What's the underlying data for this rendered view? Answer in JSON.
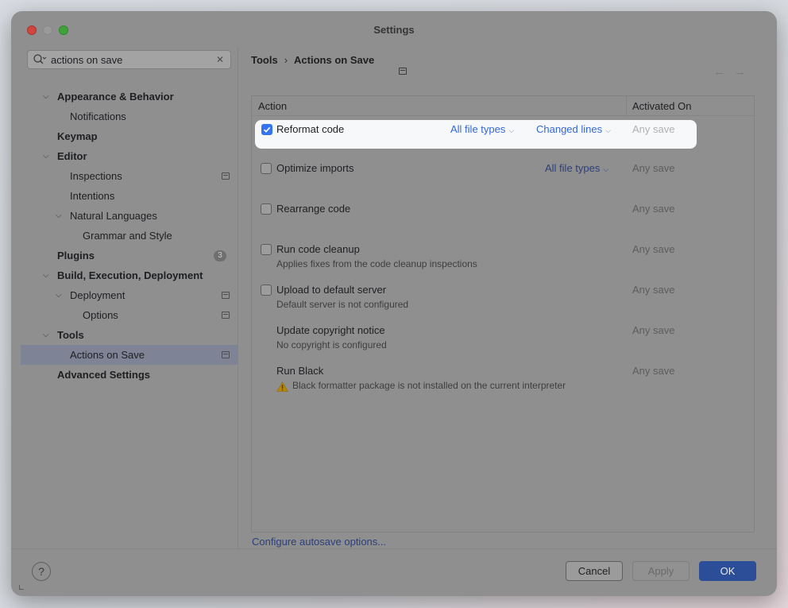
{
  "window": {
    "title": "Settings",
    "traffic_lights": [
      "close-red",
      "minimize-gray",
      "zoom-green"
    ]
  },
  "search": {
    "value": "actions on save",
    "icon": "search-icon",
    "clear_icon": "close-icon",
    "clear_glyph": "✕"
  },
  "sidebar": {
    "items": [
      {
        "label": "Appearance & Behavior",
        "bold": true,
        "expanded": true
      },
      {
        "label": "Notifications",
        "bold": false
      },
      {
        "label": "Keymap",
        "bold": true
      },
      {
        "label": "Editor",
        "bold": true,
        "expanded": true
      },
      {
        "label": "Inspections",
        "bold": false,
        "project_icon": true
      },
      {
        "label": "Intentions",
        "bold": false
      },
      {
        "label": "Natural Languages",
        "bold": false,
        "expanded": true
      },
      {
        "label": "Grammar and Style",
        "bold": false
      },
      {
        "label": "Plugins",
        "bold": true,
        "badge": "3"
      },
      {
        "label": "Build, Execution, Deployment",
        "bold": true,
        "expanded": true
      },
      {
        "label": "Deployment",
        "bold": false,
        "expanded": true,
        "project_icon": true
      },
      {
        "label": "Options",
        "bold": false,
        "project_icon": true
      },
      {
        "label": "Tools",
        "bold": true,
        "expanded": true
      },
      {
        "label": "Actions on Save",
        "bold": false,
        "selected": true,
        "project_icon": true
      },
      {
        "label": "Advanced Settings",
        "bold": true
      }
    ]
  },
  "breadcrumb": {
    "parent": "Tools",
    "separator": "›",
    "current": "Actions on Save",
    "back_glyph": "←",
    "forward_glyph": "→"
  },
  "table": {
    "headers": {
      "action": "Action",
      "activated_on": "Activated On"
    },
    "rows": [
      {
        "name": "Reformat code",
        "checked": true,
        "link1": "All file types",
        "link2": "Changed lines",
        "activated_on": "Any save",
        "highlighted": true
      },
      {
        "name": "Optimize imports",
        "checked": false,
        "link1": "All file types",
        "activated_on": "Any save"
      },
      {
        "name": "Rearrange code",
        "checked": false,
        "activated_on": "Any save"
      },
      {
        "name": "Run code cleanup",
        "checked": false,
        "description": "Applies fixes from the code cleanup inspections",
        "activated_on": "Any save"
      },
      {
        "name": "Upload to default server",
        "checked": false,
        "description": "Default server is not configured",
        "activated_on": "Any save"
      },
      {
        "name": "Update copyright notice",
        "description": "No copyright is configured",
        "activated_on": "Any save"
      },
      {
        "name": "Run Black",
        "description": "Black formatter package is not installed on the current interpreter",
        "warning": true,
        "activated_on": "Any save"
      }
    ],
    "dropdown_glyph": "⌵"
  },
  "autosave_link": "Configure autosave options...",
  "footer": {
    "help": "?",
    "cancel": "Cancel",
    "apply": "Apply",
    "ok": "OK"
  },
  "colors": {
    "link": "#3467d6",
    "checkbox_on": "#3574f0",
    "ok_button": "#2c4d98",
    "selection": "#7e8496"
  }
}
